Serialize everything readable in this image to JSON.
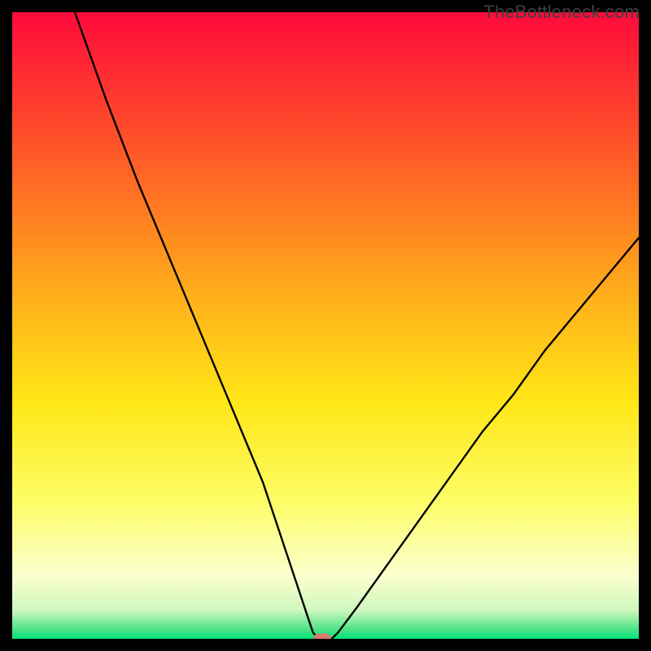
{
  "watermark": "TheBottleneck.com",
  "chart_data": {
    "type": "line",
    "title": "",
    "xlabel": "",
    "ylabel": "",
    "xlim": [
      0,
      100
    ],
    "ylim": [
      0,
      100
    ],
    "grid": false,
    "series": [
      {
        "name": "bottleneck-curve",
        "x": [
          10,
          15,
          20,
          25,
          30,
          35,
          40,
          43,
          45,
          47,
          48,
          49,
          51,
          52,
          55,
          60,
          65,
          70,
          75,
          80,
          85,
          90,
          95,
          100
        ],
        "values": [
          100,
          86,
          73,
          61,
          49,
          37,
          25,
          16,
          10,
          4,
          1,
          0,
          0,
          1,
          5,
          12,
          19,
          26,
          33,
          39,
          46,
          52,
          58,
          64
        ]
      }
    ],
    "marker": {
      "x": 49.5,
      "y": 0,
      "color": "#d97a6f"
    },
    "gradient_stops": [
      {
        "offset": 0.0,
        "color": "#ff0a3b"
      },
      {
        "offset": 0.22,
        "color": "#ff5728"
      },
      {
        "offset": 0.45,
        "color": "#ffae1a"
      },
      {
        "offset": 0.62,
        "color": "#ffe617"
      },
      {
        "offset": 0.78,
        "color": "#fdfd66"
      },
      {
        "offset": 0.9,
        "color": "#fcffcf"
      },
      {
        "offset": 0.955,
        "color": "#cdf7bd"
      },
      {
        "offset": 0.985,
        "color": "#4de387"
      },
      {
        "offset": 1.0,
        "color": "#00e47a"
      }
    ]
  }
}
